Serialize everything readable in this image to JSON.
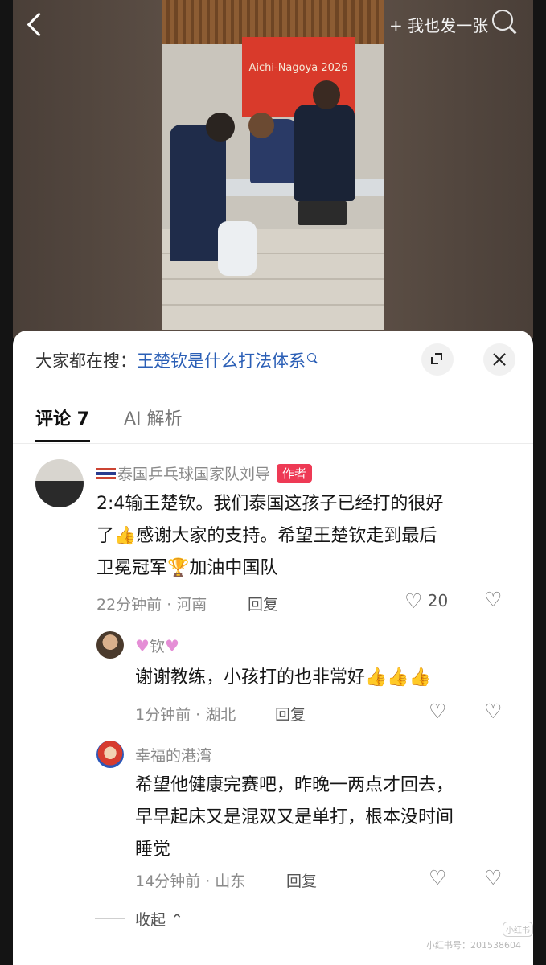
{
  "header": {
    "post_too_label": "+ 我也发一张",
    "back_icon": "chevron-left-icon",
    "search_icon": "search-icon"
  },
  "photo": {
    "banner_text": "Aichi-Nagoya 2026"
  },
  "sheet": {
    "search_prefix": "大家都在搜：",
    "search_keyword": "王楚钦是什么打法体系"
  },
  "tabs": [
    {
      "label": "评论 7"
    },
    {
      "label": "AI 解析"
    }
  ],
  "comments": [
    {
      "name": "泰国乒乓球国家队刘导",
      "badge": "作者",
      "text_line1": "2:4输王楚钦。我们泰国这孩子已经打的很好",
      "text_line2": "了👍感谢大家的支持。希望王楚钦走到最后",
      "text_line3": "卫冕冠军🏆加油中国队",
      "time_location": "22分钟前 · 河南",
      "reply": "回复",
      "likes": "20"
    }
  ],
  "replies": [
    {
      "name": "钦",
      "text": "谢谢教练，小孩打的也非常好👍👍👍",
      "time_location": "1分钟前 · 湖北",
      "reply": "回复"
    },
    {
      "name": "幸福的港湾",
      "text_line1": "希望他健康完赛吧，昨晚一两点才回去，",
      "text_line2": "早早起床又是混双又是单打，根本没时间",
      "text_line3": "睡觉",
      "time_location": "14分钟前 · 山东",
      "reply": "回复"
    }
  ],
  "collapse_label": "收起",
  "watermark": "小红书号：201538604"
}
